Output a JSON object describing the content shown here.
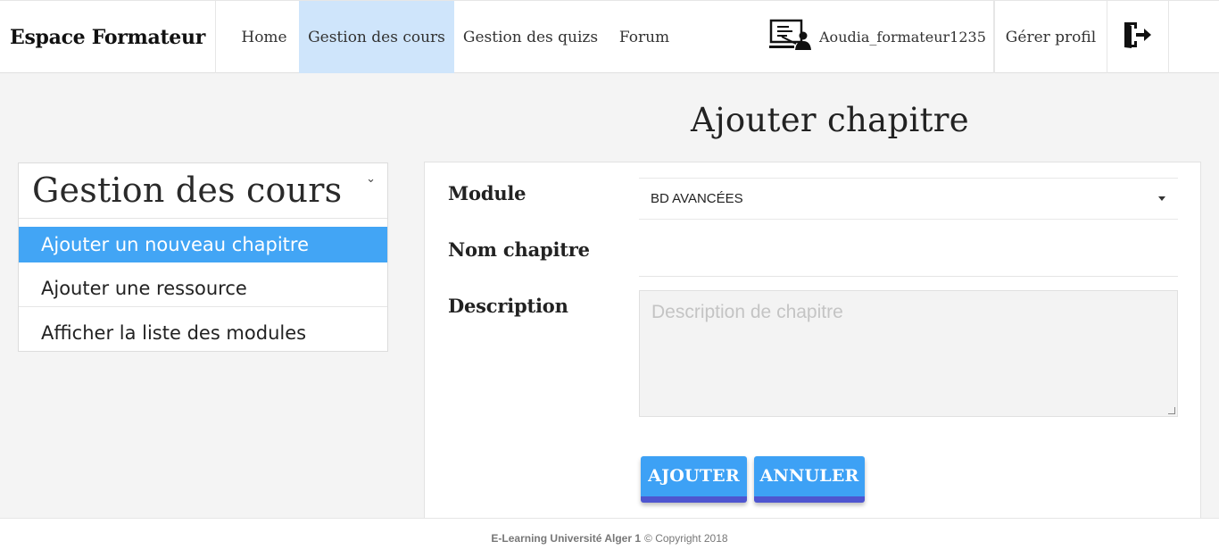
{
  "navbar": {
    "brand": "Espace Formateur",
    "links": [
      {
        "label": "Home",
        "active": false
      },
      {
        "label": "Gestion des cours",
        "active": true
      },
      {
        "label": "Gestion des quizs",
        "active": false
      },
      {
        "label": "Forum",
        "active": false
      }
    ],
    "user_icon": "teacher-board-icon",
    "username": "Aoudia_formateur1235",
    "profile_label": "Gérer profil",
    "logout_icon": "logout-door-icon"
  },
  "page": {
    "title": "Ajouter chapitre"
  },
  "sidebar": {
    "title": "Gestion des cours",
    "chevron_icon": "chevron-down-icon",
    "items": [
      {
        "label": "Ajouter un nouveau chapitre",
        "active": true
      },
      {
        "label": "Ajouter une ressource",
        "active": false
      },
      {
        "label": "Afficher la liste des modules",
        "active": false
      }
    ]
  },
  "form": {
    "module_label": "Module",
    "module_value": "BD AVANCÉES",
    "name_label": "Nom chapitre",
    "name_value": "",
    "description_label": "Description",
    "description_placeholder": "Description de chapitre",
    "add_label": "AJOUTER",
    "cancel_label": "ANNULER"
  },
  "footer": {
    "brand": "E-Learning Université Alger 1",
    "copyright": "© Copyright 2018"
  },
  "colors": {
    "active_nav_bg": "#cfe5fb",
    "active_sidebar_bg": "#42a5f5",
    "button_bg": "#3da1f5",
    "button_shadow": "#4e55d0"
  }
}
